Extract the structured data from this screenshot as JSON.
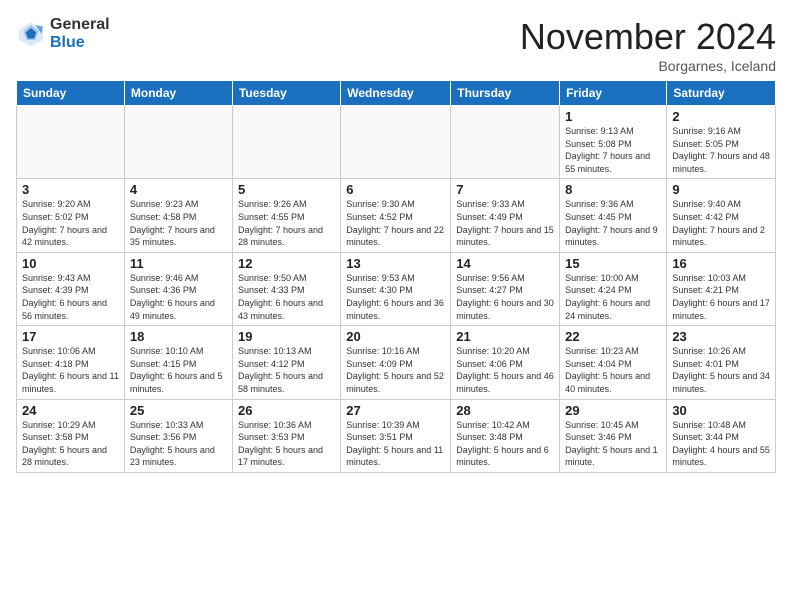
{
  "header": {
    "logo_general": "General",
    "logo_blue": "Blue",
    "month_title": "November 2024",
    "location": "Borgarnes, Iceland"
  },
  "weekdays": [
    "Sunday",
    "Monday",
    "Tuesday",
    "Wednesday",
    "Thursday",
    "Friday",
    "Saturday"
  ],
  "weeks": [
    [
      {
        "day": "",
        "info": ""
      },
      {
        "day": "",
        "info": ""
      },
      {
        "day": "",
        "info": ""
      },
      {
        "day": "",
        "info": ""
      },
      {
        "day": "",
        "info": ""
      },
      {
        "day": "1",
        "info": "Sunrise: 9:13 AM\nSunset: 5:08 PM\nDaylight: 7 hours\nand 55 minutes."
      },
      {
        "day": "2",
        "info": "Sunrise: 9:16 AM\nSunset: 5:05 PM\nDaylight: 7 hours\nand 48 minutes."
      }
    ],
    [
      {
        "day": "3",
        "info": "Sunrise: 9:20 AM\nSunset: 5:02 PM\nDaylight: 7 hours\nand 42 minutes."
      },
      {
        "day": "4",
        "info": "Sunrise: 9:23 AM\nSunset: 4:58 PM\nDaylight: 7 hours\nand 35 minutes."
      },
      {
        "day": "5",
        "info": "Sunrise: 9:26 AM\nSunset: 4:55 PM\nDaylight: 7 hours\nand 28 minutes."
      },
      {
        "day": "6",
        "info": "Sunrise: 9:30 AM\nSunset: 4:52 PM\nDaylight: 7 hours\nand 22 minutes."
      },
      {
        "day": "7",
        "info": "Sunrise: 9:33 AM\nSunset: 4:49 PM\nDaylight: 7 hours\nand 15 minutes."
      },
      {
        "day": "8",
        "info": "Sunrise: 9:36 AM\nSunset: 4:45 PM\nDaylight: 7 hours\nand 9 minutes."
      },
      {
        "day": "9",
        "info": "Sunrise: 9:40 AM\nSunset: 4:42 PM\nDaylight: 7 hours\nand 2 minutes."
      }
    ],
    [
      {
        "day": "10",
        "info": "Sunrise: 9:43 AM\nSunset: 4:39 PM\nDaylight: 6 hours\nand 56 minutes."
      },
      {
        "day": "11",
        "info": "Sunrise: 9:46 AM\nSunset: 4:36 PM\nDaylight: 6 hours\nand 49 minutes."
      },
      {
        "day": "12",
        "info": "Sunrise: 9:50 AM\nSunset: 4:33 PM\nDaylight: 6 hours\nand 43 minutes."
      },
      {
        "day": "13",
        "info": "Sunrise: 9:53 AM\nSunset: 4:30 PM\nDaylight: 6 hours\nand 36 minutes."
      },
      {
        "day": "14",
        "info": "Sunrise: 9:56 AM\nSunset: 4:27 PM\nDaylight: 6 hours\nand 30 minutes."
      },
      {
        "day": "15",
        "info": "Sunrise: 10:00 AM\nSunset: 4:24 PM\nDaylight: 6 hours\nand 24 minutes."
      },
      {
        "day": "16",
        "info": "Sunrise: 10:03 AM\nSunset: 4:21 PM\nDaylight: 6 hours\nand 17 minutes."
      }
    ],
    [
      {
        "day": "17",
        "info": "Sunrise: 10:06 AM\nSunset: 4:18 PM\nDaylight: 6 hours\nand 11 minutes."
      },
      {
        "day": "18",
        "info": "Sunrise: 10:10 AM\nSunset: 4:15 PM\nDaylight: 6 hours\nand 5 minutes."
      },
      {
        "day": "19",
        "info": "Sunrise: 10:13 AM\nSunset: 4:12 PM\nDaylight: 5 hours\nand 58 minutes."
      },
      {
        "day": "20",
        "info": "Sunrise: 10:16 AM\nSunset: 4:09 PM\nDaylight: 5 hours\nand 52 minutes."
      },
      {
        "day": "21",
        "info": "Sunrise: 10:20 AM\nSunset: 4:06 PM\nDaylight: 5 hours\nand 46 minutes."
      },
      {
        "day": "22",
        "info": "Sunrise: 10:23 AM\nSunset: 4:04 PM\nDaylight: 5 hours\nand 40 minutes."
      },
      {
        "day": "23",
        "info": "Sunrise: 10:26 AM\nSunset: 4:01 PM\nDaylight: 5 hours\nand 34 minutes."
      }
    ],
    [
      {
        "day": "24",
        "info": "Sunrise: 10:29 AM\nSunset: 3:58 PM\nDaylight: 5 hours\nand 28 minutes."
      },
      {
        "day": "25",
        "info": "Sunrise: 10:33 AM\nSunset: 3:56 PM\nDaylight: 5 hours\nand 23 minutes."
      },
      {
        "day": "26",
        "info": "Sunrise: 10:36 AM\nSunset: 3:53 PM\nDaylight: 5 hours\nand 17 minutes."
      },
      {
        "day": "27",
        "info": "Sunrise: 10:39 AM\nSunset: 3:51 PM\nDaylight: 5 hours\nand 11 minutes."
      },
      {
        "day": "28",
        "info": "Sunrise: 10:42 AM\nSunset: 3:48 PM\nDaylight: 5 hours\nand 6 minutes."
      },
      {
        "day": "29",
        "info": "Sunrise: 10:45 AM\nSunset: 3:46 PM\nDaylight: 5 hours\nand 1 minute."
      },
      {
        "day": "30",
        "info": "Sunrise: 10:48 AM\nSunset: 3:44 PM\nDaylight: 4 hours\nand 55 minutes."
      }
    ]
  ]
}
